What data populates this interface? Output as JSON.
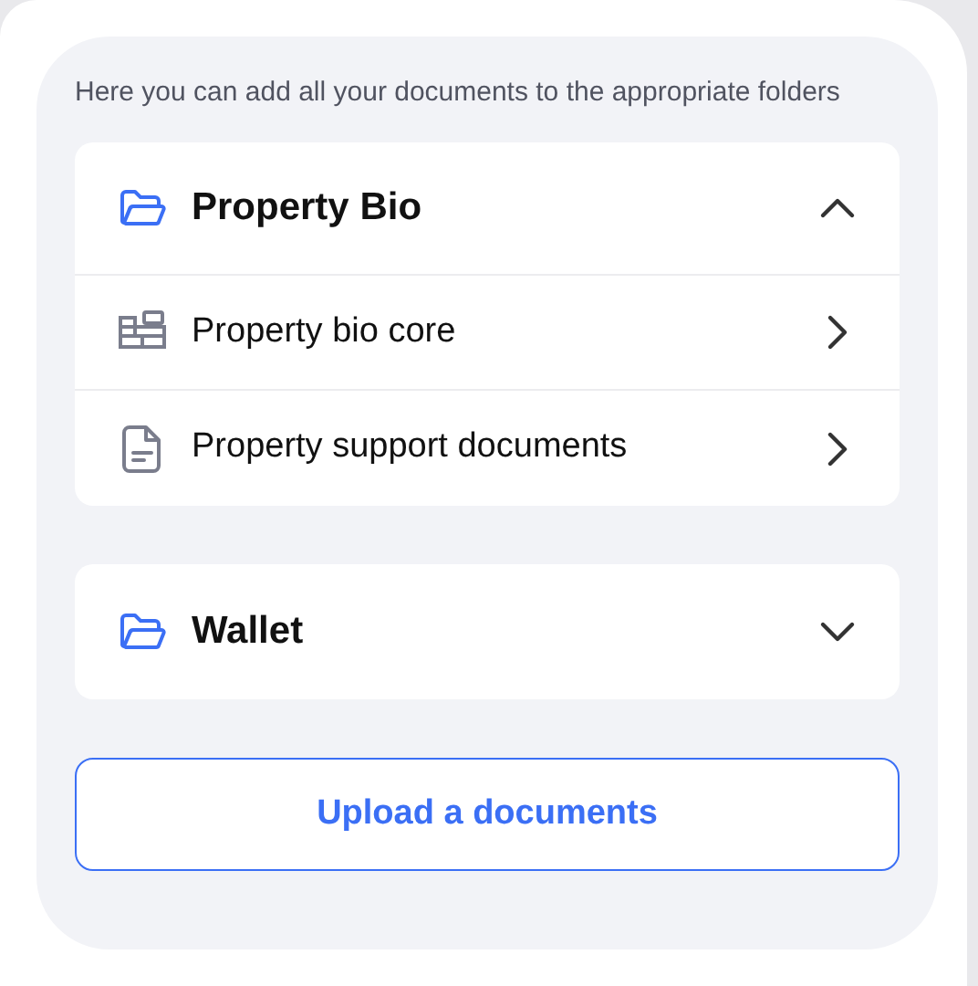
{
  "description": "Here you can add all your documents to the appropriate folders",
  "folders": [
    {
      "title": "Property Bio",
      "expanded": true,
      "items": [
        {
          "label": "Property bio core",
          "kind": "blocks"
        },
        {
          "label": "Property support documents",
          "kind": "document"
        }
      ]
    },
    {
      "title": "Wallet",
      "expanded": false
    }
  ],
  "upload_button": "Upload a documents"
}
